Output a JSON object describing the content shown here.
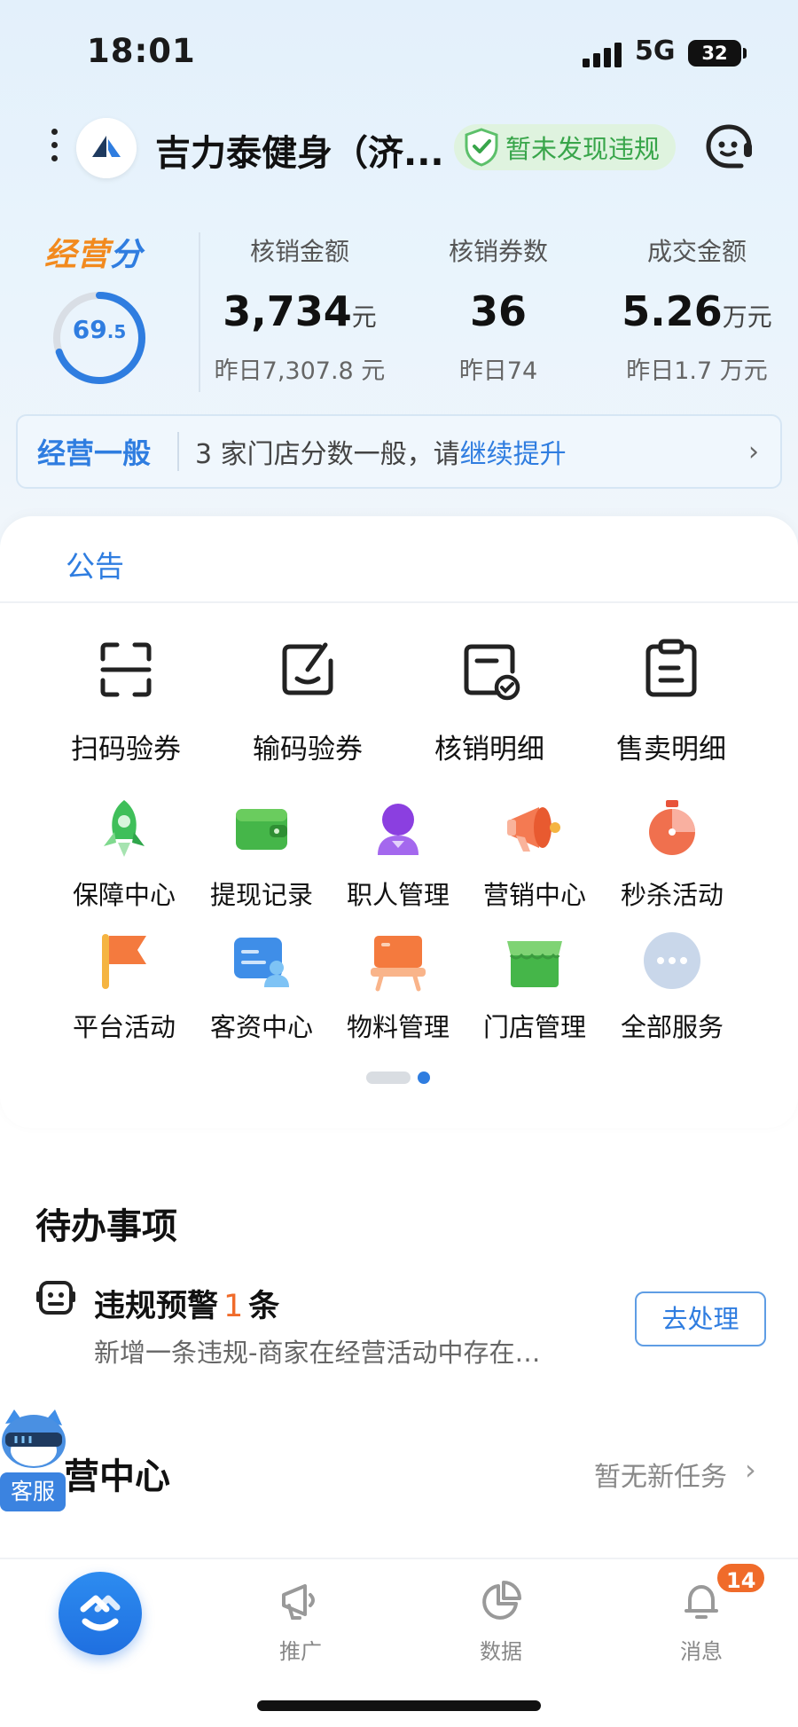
{
  "status_bar": {
    "time": "18:01",
    "network": "5G",
    "battery": "32"
  },
  "header": {
    "store_name": "吉力泰健身（济...",
    "compliance": "暂未发现违规",
    "icons": [
      "menu-dots-icon",
      "store-logo",
      "shield-check-icon",
      "customer-service-icon"
    ]
  },
  "score": {
    "title_part1": "经营",
    "title_part2": "分",
    "value": "69",
    "decimal": ".5",
    "progress": 0.695
  },
  "stats": [
    {
      "label": "核销金额",
      "value": "3,734",
      "unit": "元",
      "yesterday": "昨日7,307.8 元"
    },
    {
      "label": "核销券数",
      "value": "36",
      "unit": "",
      "yesterday": "昨日74"
    },
    {
      "label": "成交金额",
      "value": "5.26",
      "unit": "万元",
      "yesterday": "昨日1.7 万元"
    }
  ],
  "banner": {
    "tag": "经营一般",
    "message": "3 家门店分数一般，请",
    "link": "继续提升"
  },
  "notice": {
    "tab": "公告"
  },
  "tools": [
    {
      "label": "扫码验券",
      "icon": "scan-icon"
    },
    {
      "label": "输码验券",
      "icon": "edit-code-icon"
    },
    {
      "label": "核销明细",
      "icon": "verify-detail-icon"
    },
    {
      "label": "售卖明细",
      "icon": "sales-detail-icon"
    }
  ],
  "services_row1": [
    {
      "label": "保障中心",
      "icon": "rocket-icon"
    },
    {
      "label": "提现记录",
      "icon": "wallet-icon"
    },
    {
      "label": "职人管理",
      "icon": "person-icon"
    },
    {
      "label": "营销中心",
      "icon": "megaphone-icon"
    },
    {
      "label": "秒杀活动",
      "icon": "stopwatch-icon"
    }
  ],
  "services_row2": [
    {
      "label": "平台活动",
      "icon": "flag-icon"
    },
    {
      "label": "客资中心",
      "icon": "contact-card-icon"
    },
    {
      "label": "物料管理",
      "icon": "easel-icon"
    },
    {
      "label": "门店管理",
      "icon": "store-icon"
    },
    {
      "label": "全部服务",
      "icon": "more-dots-icon"
    }
  ],
  "todo": {
    "title": "待办事项",
    "item_title": "违规预警",
    "item_count": "1",
    "item_unit": "条",
    "item_desc": "新增一条违规-商家在经营活动中存在…",
    "action": "去处理"
  },
  "growth": {
    "title": "营中心",
    "status": "暂无新任务"
  },
  "helper": {
    "label": "客服"
  },
  "tabbar": {
    "items": [
      {
        "label": "推广",
        "icon": "promote-icon"
      },
      {
        "label": "数据",
        "icon": "data-pie-icon"
      },
      {
        "label": "消息",
        "icon": "bell-icon"
      }
    ],
    "badge": "14"
  },
  "colors": {
    "accent": "#2f7de0",
    "orange": "#f06b2a",
    "green": "#38a54a"
  }
}
